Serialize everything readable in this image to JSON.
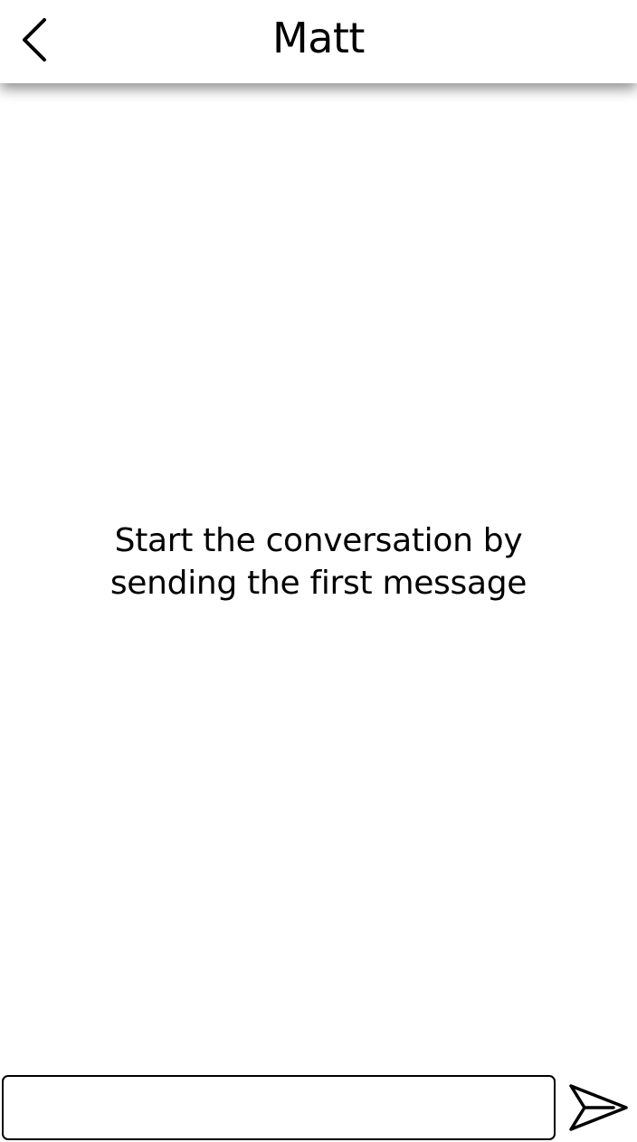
{
  "header": {
    "title": "Matt",
    "back_icon": "chevron-left-icon"
  },
  "conversation": {
    "empty_line_1": "Start the conversation by",
    "empty_line_2": "sending the first message"
  },
  "composer": {
    "input_value": "",
    "placeholder": "",
    "send_icon": "send-icon"
  },
  "colors": {
    "background": "#ffffff",
    "text": "#000000"
  }
}
